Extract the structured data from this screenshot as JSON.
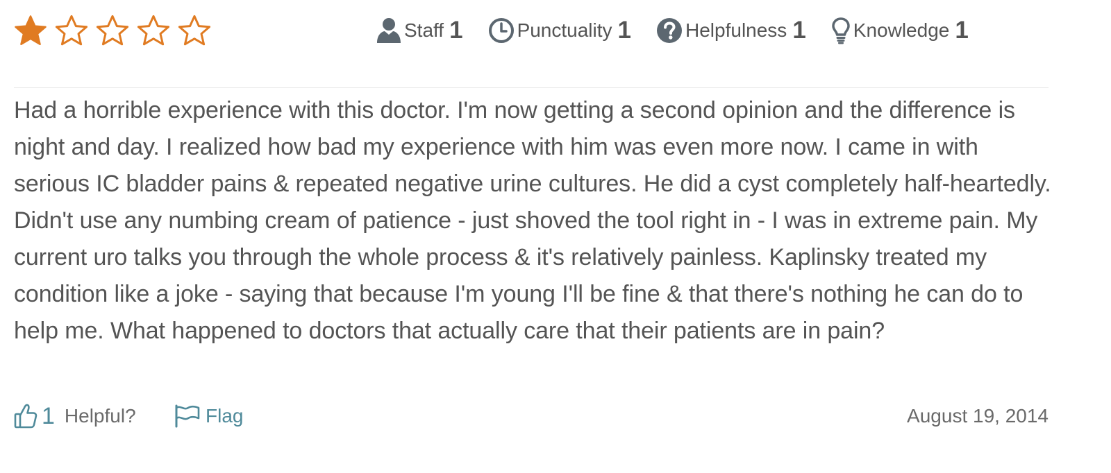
{
  "rating": {
    "stars_filled": 1,
    "stars_total": 5,
    "filled_color": "#e07b22",
    "empty_color": "#e07b22"
  },
  "categories": [
    {
      "label": "Staff",
      "value": "1",
      "icon": "user-icon"
    },
    {
      "label": "Punctuality",
      "value": "1",
      "icon": "clock-icon"
    },
    {
      "label": "Helpfulness",
      "value": "1",
      "icon": "question-circle-icon"
    },
    {
      "label": "Knowledge",
      "value": "1",
      "icon": "lightbulb-icon"
    }
  ],
  "review": {
    "text": "Had a horrible experience with this doctor. I'm now getting a second opinion and the difference is night and day. I realized how bad my experience with him was even more now. I came in with serious IC bladder pains & repeated negative urine cultures. He did a cyst completely half-heartedly. Didn't use any numbing cream of patience - just shoved the tool right in - I was in extreme pain. My current uro talks you through the whole process & it's relatively painless. Kaplinsky treated my condition like a joke - saying that because I'm young I'll be fine & that there's nothing he can do to help me. What happened to doctors that actually care that their patients are in pain?"
  },
  "footer": {
    "helpful_count": "1",
    "helpful_label": "Helpful?",
    "flag_label": "Flag",
    "date": "August 19, 2014"
  },
  "colors": {
    "accent": "#4f8a9a",
    "text": "#545454",
    "icon": "#5c6770"
  }
}
